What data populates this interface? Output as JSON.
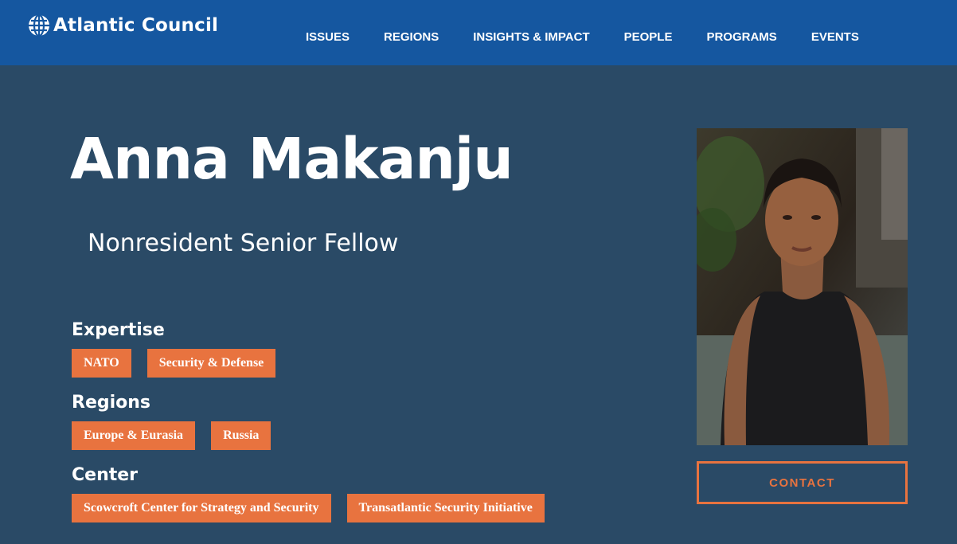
{
  "header": {
    "logo_text": "Atlantic Council",
    "logo_icon": "globe-icon",
    "nav": [
      "ISSUES",
      "REGIONS",
      "INSIGHTS & IMPACT",
      "PEOPLE",
      "PROGRAMS",
      "EVENTS"
    ]
  },
  "profile": {
    "name": "Anna Makanju",
    "title": "Nonresident Senior Fellow",
    "contact_label": "CONTACT"
  },
  "sections": {
    "expertise": {
      "label": "Expertise",
      "tags": [
        "NATO",
        "Security & Defense"
      ]
    },
    "regions": {
      "label": "Regions",
      "tags": [
        "Europe & Eurasia",
        "Russia"
      ]
    },
    "center": {
      "label": "Center",
      "tags": [
        "Scowcroft Center for Strategy and Security",
        "Transatlantic Security Initiative"
      ]
    }
  },
  "colors": {
    "header_bg": "#1557a0",
    "page_bg": "#2a4a66",
    "accent": "#e8733f"
  }
}
